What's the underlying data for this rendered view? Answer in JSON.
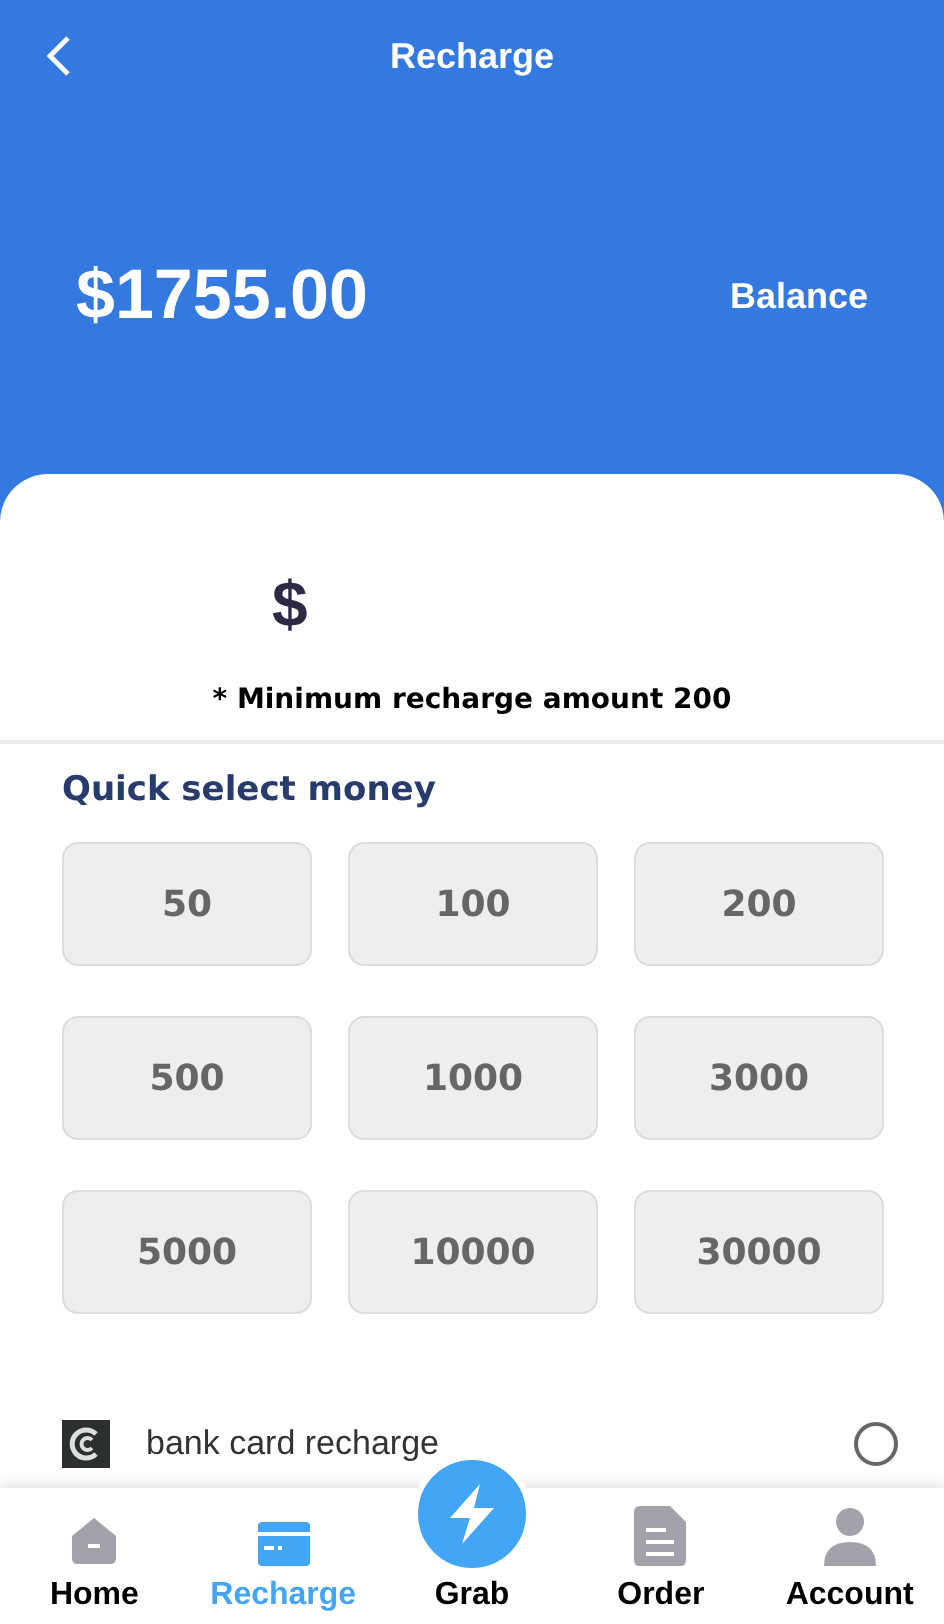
{
  "header": {
    "title": "Recharge",
    "balance_amount": "$1755.00",
    "balance_label": "Balance"
  },
  "amount_field": {
    "currency": "$"
  },
  "minimum_note": "* Minimum recharge amount 200",
  "quick_select": {
    "title": "Quick select money",
    "amounts": [
      {
        "label": "50",
        "selected": false
      },
      {
        "label": "100",
        "selected": false
      },
      {
        "label": "200",
        "selected": false
      },
      {
        "label": "500",
        "selected": false
      },
      {
        "label": "1000",
        "selected": false
      },
      {
        "label": "3000",
        "selected": false
      },
      {
        "label": "5000",
        "selected": false
      },
      {
        "label": "10000",
        "selected": false
      },
      {
        "label": "30000",
        "selected": false
      }
    ]
  },
  "payment_methods": [
    {
      "label": "bank card recharge",
      "selected": false
    }
  ],
  "bottom_nav": [
    {
      "label": "Home",
      "kind": "home",
      "selected": false
    },
    {
      "label": "Recharge",
      "kind": "card",
      "selected": true
    },
    {
      "label": "Grab",
      "kind": "grab",
      "selected": false
    },
    {
      "label": "Order",
      "kind": "doc",
      "selected": false
    },
    {
      "label": "Account",
      "kind": "person",
      "selected": false
    }
  ]
}
